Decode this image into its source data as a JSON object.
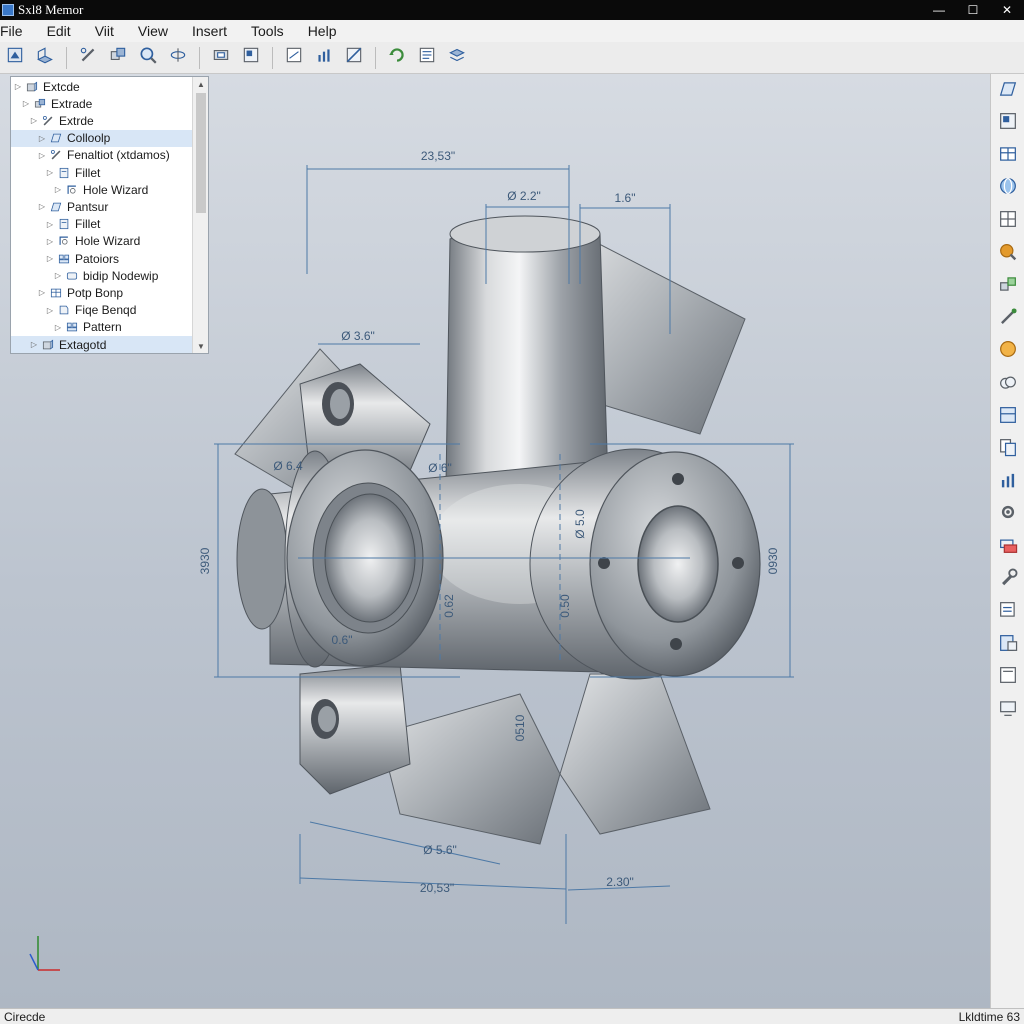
{
  "window": {
    "title": "Sxl8 Memor",
    "minimize": "—",
    "maximize": "☐",
    "close": "✕"
  },
  "menu": [
    {
      "id": "file",
      "label": "File"
    },
    {
      "id": "edit",
      "label": "Edit"
    },
    {
      "id": "view-1",
      "label": "Viit"
    },
    {
      "id": "view-2",
      "label": "View"
    },
    {
      "id": "insert",
      "label": "Insert"
    },
    {
      "id": "tools",
      "label": "Tools"
    },
    {
      "id": "help",
      "label": "Help"
    }
  ],
  "toolbar_icons": [
    "new-part-icon",
    "extrude-icon",
    "sketch-icon",
    "assembly-icon",
    "zoom-icon",
    "revolve-icon",
    "cut-icon",
    "view-icon",
    "drawing-icon",
    "chart-icon",
    "section-icon",
    "rebuild-icon",
    "properties-icon",
    "layers-icon"
  ],
  "tree": {
    "items": [
      {
        "label": "Extcde",
        "depth": 0,
        "icon": "feature-icon",
        "selected": false
      },
      {
        "label": "Extrade",
        "depth": 1,
        "icon": "assembly-icon",
        "selected": false
      },
      {
        "label": "Extrde",
        "depth": 2,
        "icon": "sketch-icon",
        "selected": false
      },
      {
        "label": "Colloolp",
        "depth": 3,
        "icon": "plane-icon",
        "selected": true
      },
      {
        "label": "Fenaltiot (xtdamos)",
        "depth": 3,
        "icon": "sketch-icon",
        "selected": false
      },
      {
        "label": "Fillet",
        "depth": 4,
        "icon": "fillet-icon",
        "selected": false
      },
      {
        "label": "Hole Wizard",
        "depth": 5,
        "icon": "hole-icon",
        "selected": false
      },
      {
        "label": "Pantsur",
        "depth": 3,
        "icon": "plane-icon",
        "selected": false
      },
      {
        "label": "Fillet",
        "depth": 4,
        "icon": "fillet-icon",
        "selected": false
      },
      {
        "label": "Hole Wizard",
        "depth": 4,
        "icon": "hole-icon",
        "selected": false
      },
      {
        "label": "Patoiors",
        "depth": 4,
        "icon": "pattern-icon",
        "selected": false
      },
      {
        "label": "bidip Nodewip",
        "depth": 5,
        "icon": "body-icon",
        "selected": false
      },
      {
        "label": "Potp Bonp",
        "depth": 3,
        "icon": "table-icon",
        "selected": false
      },
      {
        "label": "Fiqe Benqd",
        "depth": 4,
        "icon": "sheet-icon",
        "selected": false
      },
      {
        "label": "Pattern",
        "depth": 5,
        "icon": "pattern-icon",
        "selected": false
      },
      {
        "label": "Extagotd",
        "depth": 2,
        "icon": "feature-icon",
        "selected": true
      }
    ]
  },
  "task_icons": [
    "plane-icon",
    "view-icon",
    "table-icon",
    "globe-icon",
    "grid-icon",
    "appearance-icon",
    "mate-icon",
    "probe-icon",
    "color-icon",
    "cloud-icon",
    "layout-icon",
    "copy-icon",
    "chart-icon",
    "settings-icon",
    "stack-icon",
    "wrench-icon",
    "note-icon",
    "file-icon",
    "measure-icon",
    "screen-icon"
  ],
  "dimensions": {
    "top_overall": "23,53\"",
    "top_dia": "Ø 2.2\"",
    "top_right": "1.6\"",
    "left_bore": "Ø 3.6\"",
    "left_small": "Ø 6.4",
    "center_dia": "Ø 6\"",
    "right_vertical": "Ø 5.0",
    "left_height": "3930",
    "right_height": "0930",
    "center_vert": "0.62",
    "center_vert_2": "0.50",
    "lower_vert": "0510",
    "lower_left": "0.6\"",
    "bottom_dia": "Ø 5.6\"",
    "bottom_overall": "20,53\"",
    "bottom_right": "2.30\""
  },
  "status": {
    "left": "Cirecde",
    "right": "Lkldtime 63"
  }
}
